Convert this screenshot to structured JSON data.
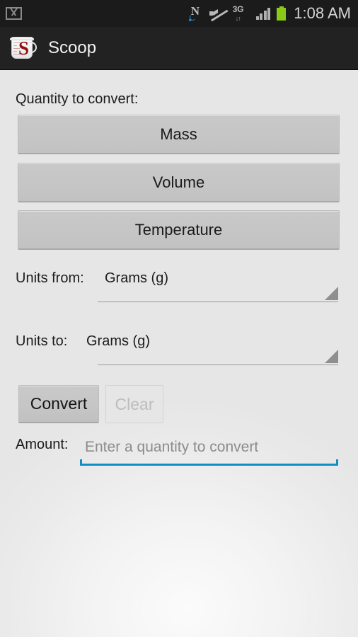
{
  "status_bar": {
    "notification_icons": [
      "gmail-icon"
    ],
    "system_icons": [
      "nfc-icon",
      "volume-muted-icon",
      "3g-data-icon",
      "signal-bars-icon",
      "battery-icon"
    ],
    "data_type": "3G",
    "time": "1:08 AM",
    "battery_color": "#8bc919",
    "background": "#1b1b1b"
  },
  "action_bar": {
    "title": "Scoop",
    "logo": "measuring-cup-icon",
    "logo_letter": "S",
    "background": "#222222"
  },
  "main": {
    "quantity_label": "Quantity to convert:",
    "quantity_buttons": [
      {
        "label": "Mass"
      },
      {
        "label": "Volume"
      },
      {
        "label": "Temperature"
      }
    ],
    "units_from": {
      "label": "Units from:",
      "value": "Grams (g)"
    },
    "units_to": {
      "label": "Units to:",
      "value": "Grams (g)"
    },
    "convert_button": "Convert",
    "clear_button": "Clear",
    "amount": {
      "label": "Amount:",
      "value": "",
      "placeholder": "Enter a quantity to convert",
      "focus_color": "#0f8fc6"
    }
  }
}
